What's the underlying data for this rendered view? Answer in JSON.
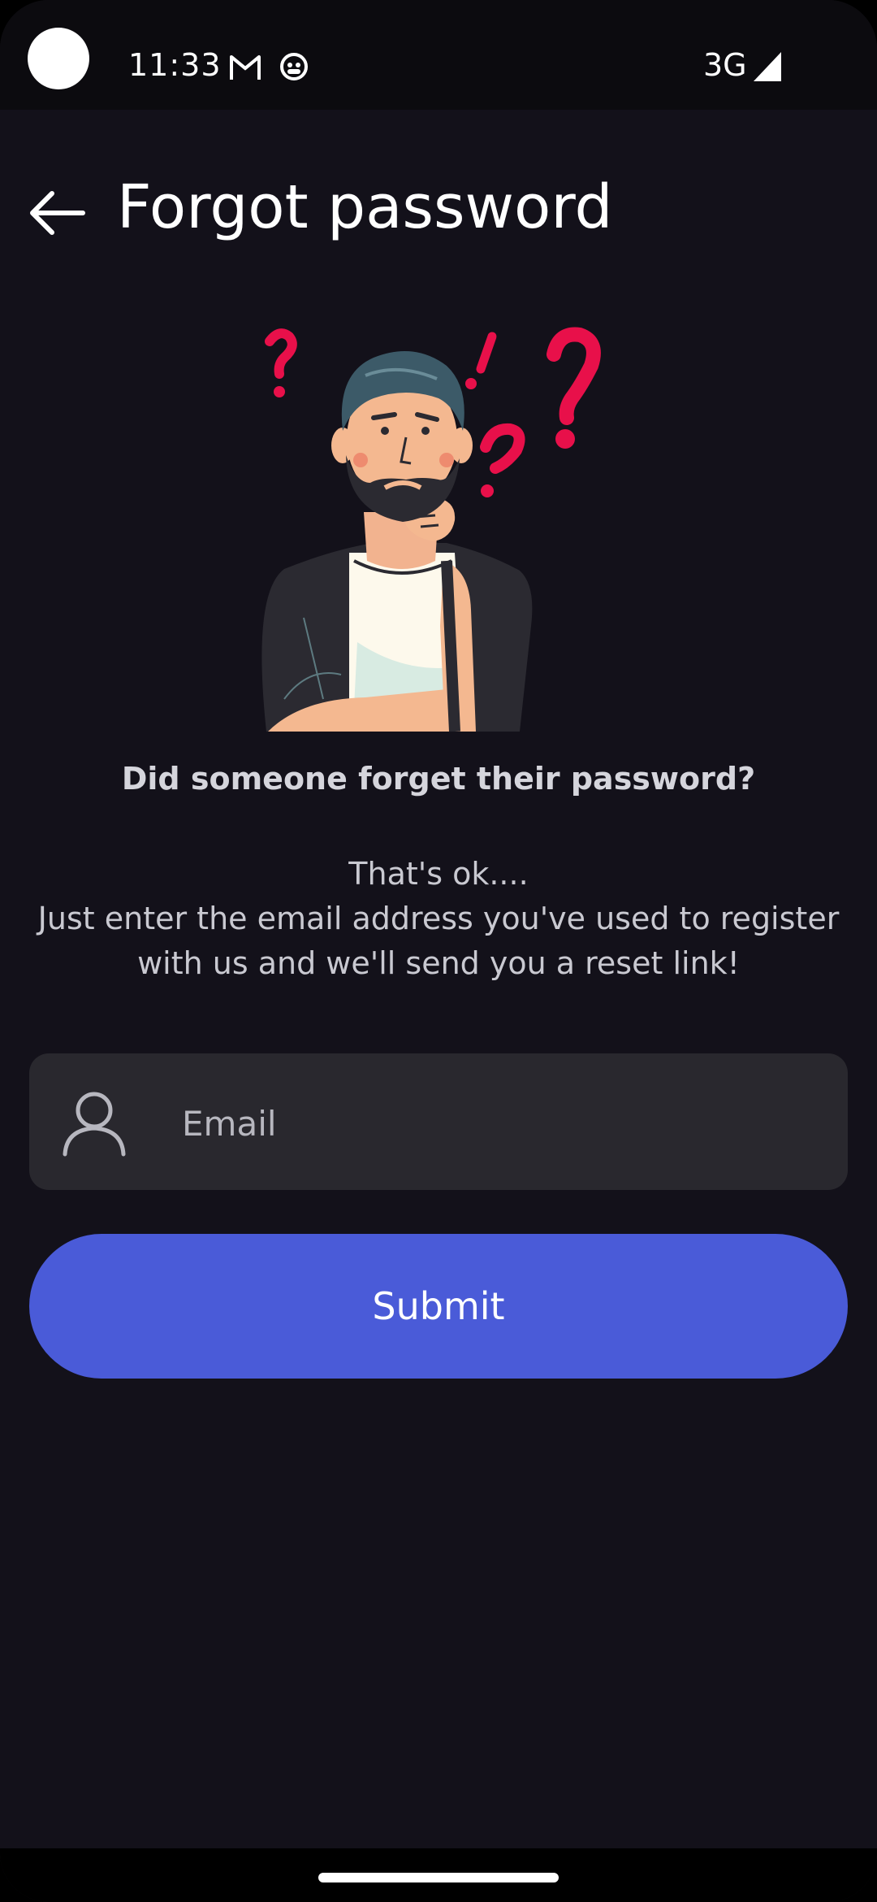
{
  "status_bar": {
    "time": "11:33",
    "network": "3G",
    "icons": [
      "gmail-icon",
      "app-notification-icon",
      "signal-icon"
    ]
  },
  "header": {
    "title": "Forgot password",
    "back_icon": "arrow-left-icon"
  },
  "illustration": {
    "subject": "confused-man-illustration"
  },
  "message": {
    "question": "Did someone forget their password?",
    "line1": "That's ok....",
    "line2": "Just enter the email address you've used to register with us and we'll send you a reset link!"
  },
  "form": {
    "email_placeholder": "Email",
    "email_value": "",
    "email_icon": "person-icon",
    "submit_label": "Submit"
  },
  "colors": {
    "background": "#13111a",
    "accent": "#4a5bd8",
    "field": "#29282e",
    "question_mark": "#e8104a"
  }
}
